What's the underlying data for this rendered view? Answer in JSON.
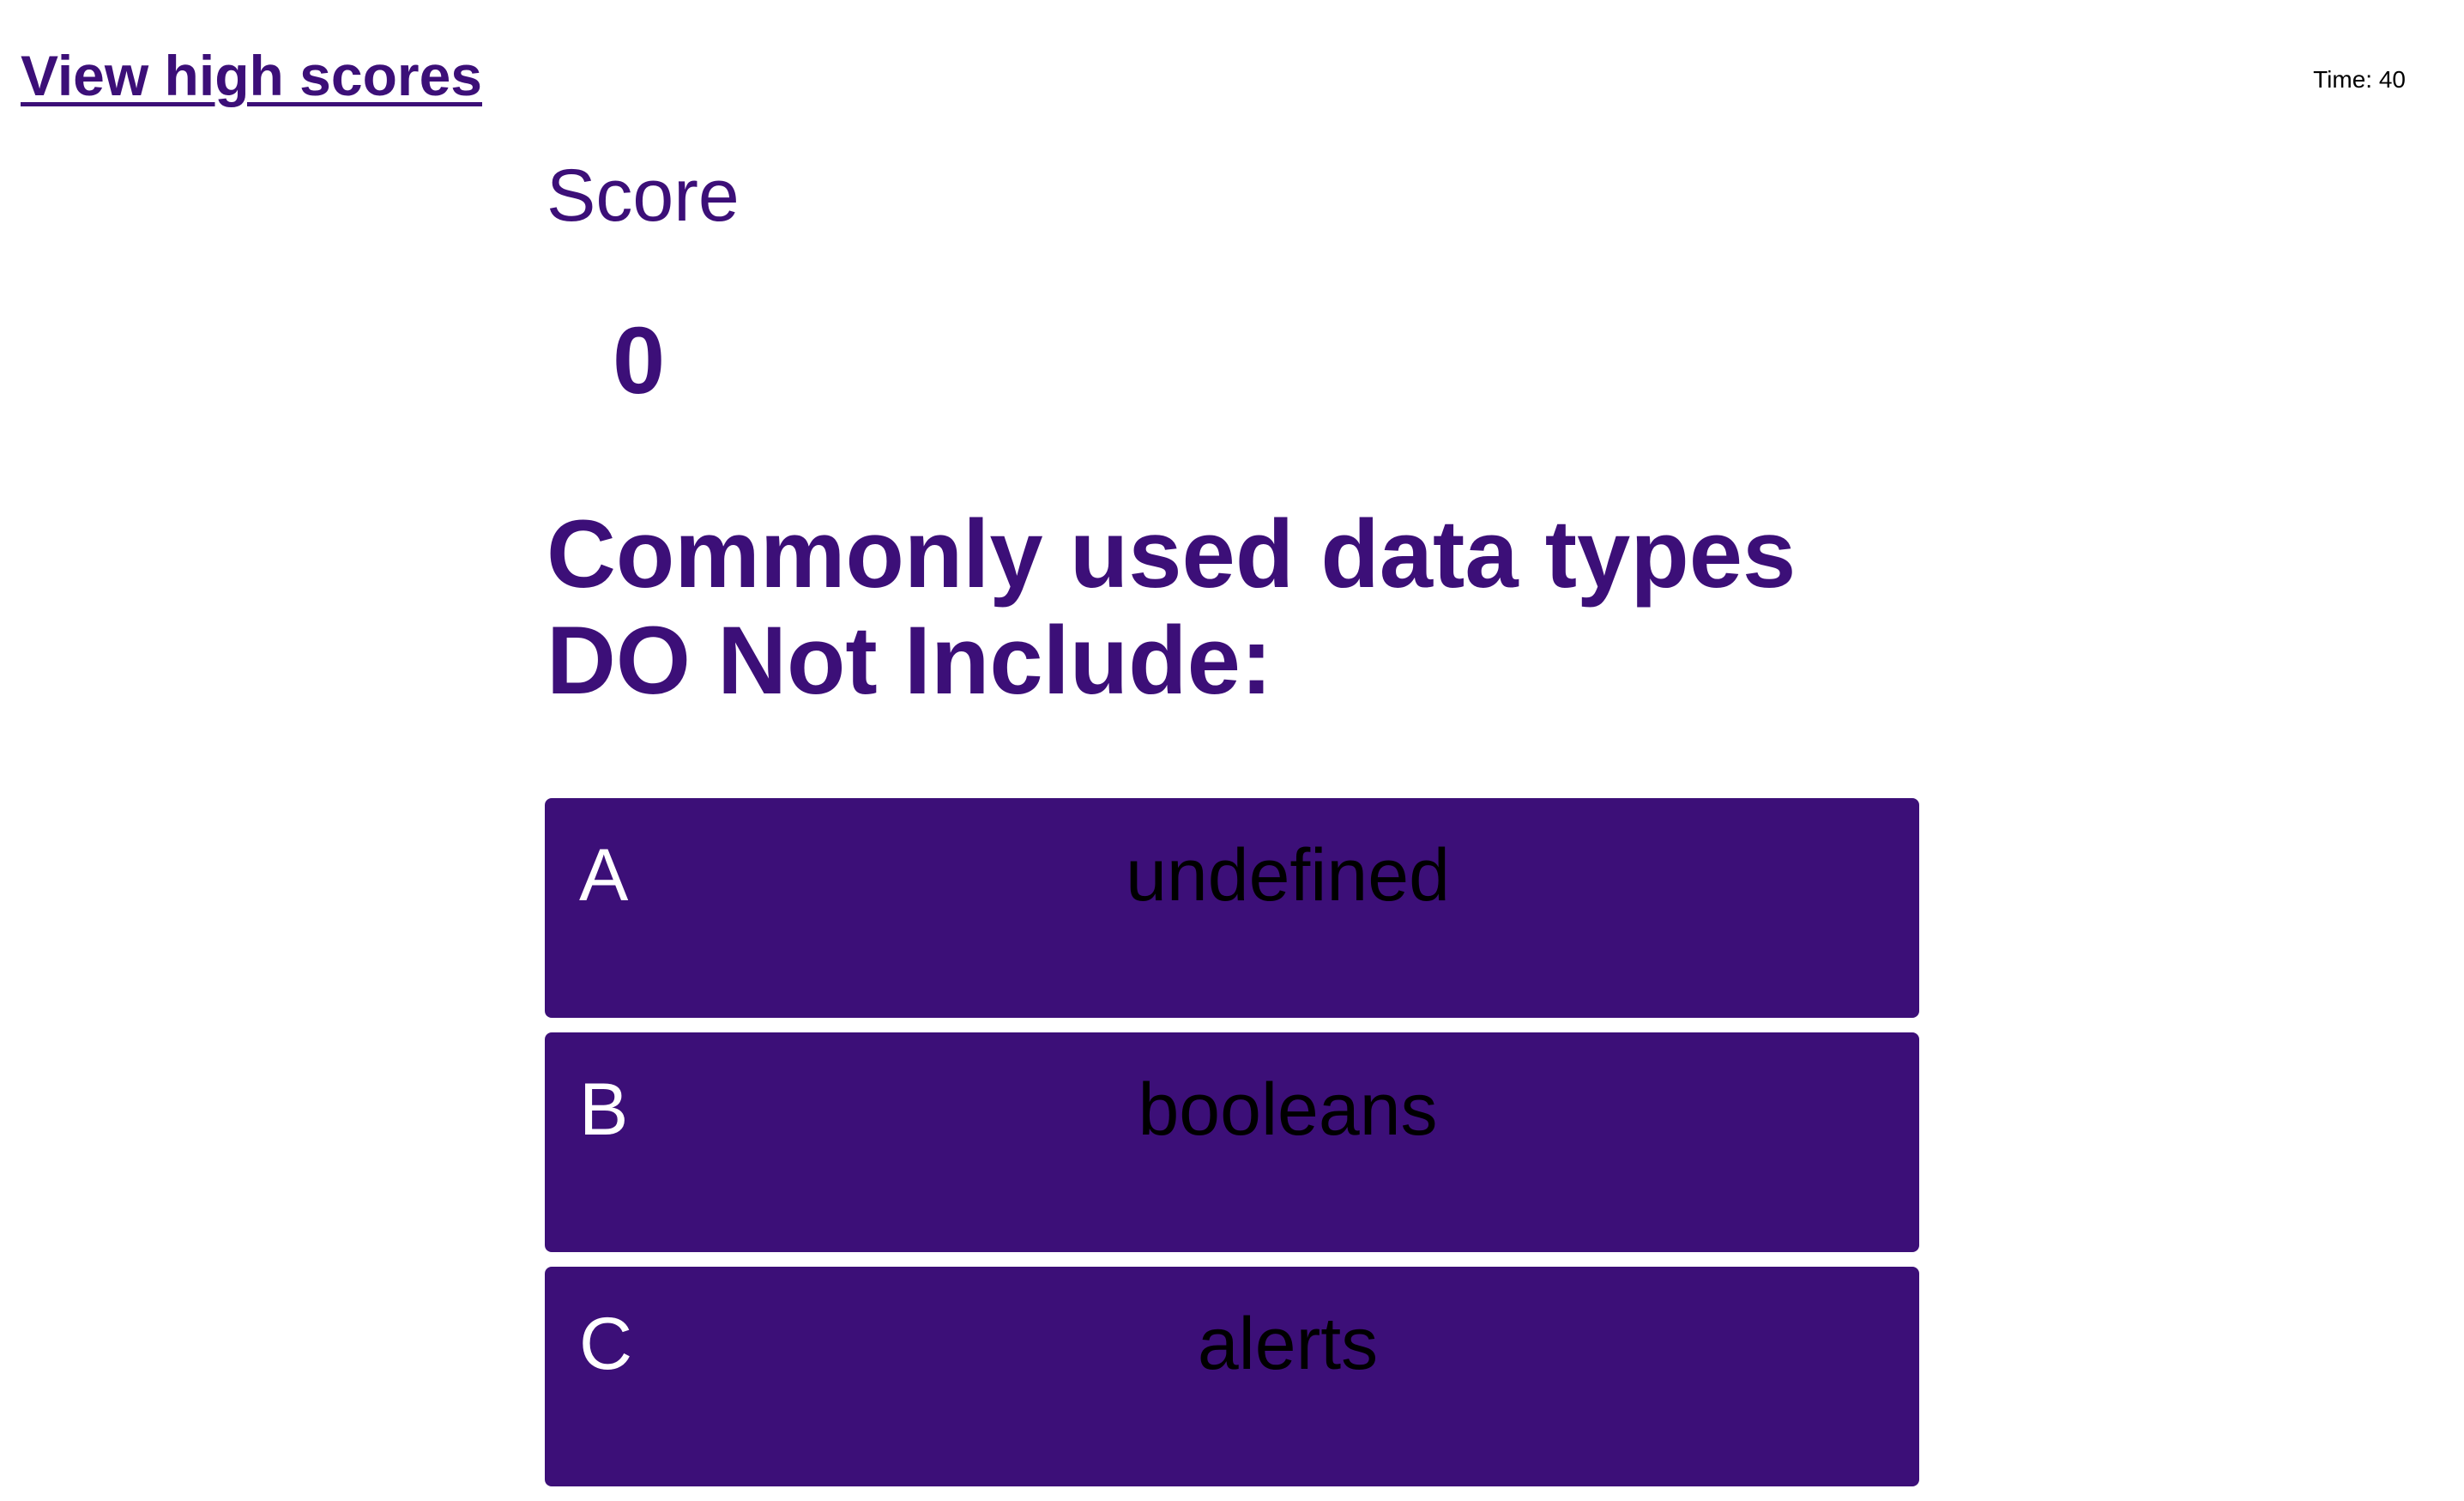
{
  "header": {
    "high_scores_link": "View high scores",
    "timer_label": "Time:",
    "timer_value": "40"
  },
  "score": {
    "label": "Score",
    "value": "0"
  },
  "question": {
    "text": "Commonly used data types DO Not Include:"
  },
  "answers": [
    {
      "letter": "A",
      "text": "undefined"
    },
    {
      "letter": "B",
      "text": "booleans"
    },
    {
      "letter": "C",
      "text": "alerts"
    }
  ],
  "colors": {
    "brand": "#3c0f78",
    "background": "#ffffff",
    "answer_text": "#000000",
    "answer_letter": "#ffffff"
  }
}
